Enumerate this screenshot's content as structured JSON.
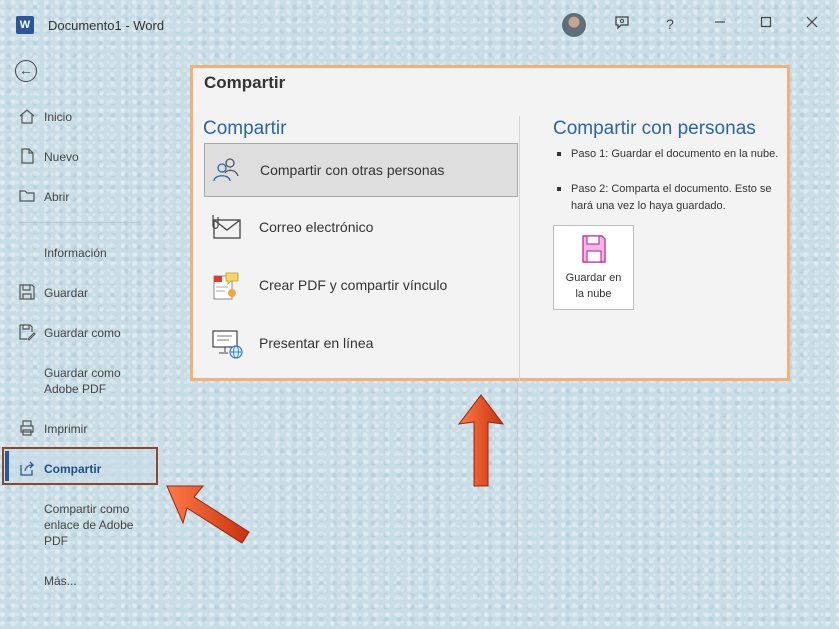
{
  "window": {
    "app_icon": "W",
    "title": "Documento1  -  Word",
    "help": "?"
  },
  "sidebar": {
    "items": [
      {
        "label": "Inicio",
        "icon": "home-icon"
      },
      {
        "label": "Nuevo",
        "icon": "new-document-icon"
      },
      {
        "label": "Abrir",
        "icon": "folder-icon"
      },
      {
        "label": "Información",
        "icon": ""
      },
      {
        "label": "Guardar",
        "icon": "save-icon"
      },
      {
        "label": "Guardar como",
        "icon": "save-as-icon"
      },
      {
        "label": "Guardar como Adobe PDF",
        "icon": ""
      },
      {
        "label": "Imprimir",
        "icon": "printer-icon"
      },
      {
        "label": "Compartir",
        "icon": "share-icon"
      },
      {
        "label": "Compartir como enlace de Adobe PDF",
        "icon": ""
      },
      {
        "label": "Más...",
        "icon": ""
      }
    ],
    "active": "Compartir"
  },
  "panel": {
    "title": "Compartir",
    "left_heading": "Compartir",
    "options": [
      {
        "label": "Compartir con otras personas",
        "icon": "people-icon",
        "selected": true
      },
      {
        "label": "Correo electrónico",
        "icon": "email-icon",
        "selected": false
      },
      {
        "label": "Crear PDF y compartir vínculo",
        "icon": "pdf-share-icon",
        "selected": false
      },
      {
        "label": "Presentar en línea",
        "icon": "present-online-icon",
        "selected": false
      }
    ],
    "right_heading": "Compartir con personas",
    "steps": [
      "Paso 1: Guardar el documento en la nube.",
      "Paso 2: Comparta el documento. Esto se hará una vez lo haya guardado."
    ],
    "save_cloud_button": {
      "line1": "Guardar en",
      "line2": "la nube"
    }
  },
  "colors": {
    "accent": "#2b579a",
    "heading": "#2b64a8",
    "highlight_border": "#f2b07a",
    "arrow": "#e8441c"
  }
}
